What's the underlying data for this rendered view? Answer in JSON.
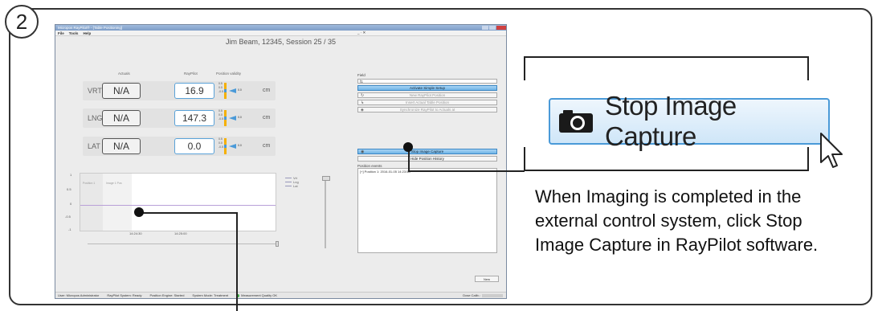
{
  "step_number": "2",
  "window": {
    "title": "Micropos RayPilot® - [Table Positioning]",
    "menu": [
      "File",
      "Tools",
      "Help"
    ],
    "menu_right": "_ · ✕"
  },
  "session_title": "Jim Beam, 12345, Session 25 / 35",
  "headers": {
    "actuals": "Actuals",
    "raypilot": "RayPilot",
    "validity": "Position validity"
  },
  "rows": [
    {
      "axis": "VRT",
      "actual": "N/A",
      "raypilot": "16.9",
      "unit": "cm",
      "arrow_value": "0.0"
    },
    {
      "axis": "LNG",
      "actual": "N/A",
      "raypilot": "147.3",
      "unit": "cm",
      "arrow_value": "0.0"
    },
    {
      "axis": "LAT",
      "actual": "N/A",
      "raypilot": "0.0",
      "unit": "cm",
      "arrow_value": "0.0"
    }
  ],
  "validity_ticks": [
    "0.5",
    "0.0",
    "-0.5"
  ],
  "plot": {
    "y_ticks": [
      "1",
      "0.5",
      "0",
      "-0.5",
      "-1"
    ],
    "x_ticks": [
      "14:24:30",
      "14:25:00"
    ],
    "region_labels": [
      "Position 1",
      "Image 1 Pos"
    ],
    "legend": [
      "Vrt",
      "Lng",
      "Lat"
    ]
  },
  "right_panel": {
    "field_label": "Field",
    "field_value": "f1",
    "buttons": {
      "activate": "Activate Simple Setup",
      "new_position": "New RayPilot Position",
      "insert_actual": "Insert Actual Table Position",
      "synchronize": "Synchronize RayPilot to Actuals at",
      "stop_capture": "Stop Image Capture",
      "hide_history": "Hide Position History"
    },
    "events_label": "Position events",
    "events": [
      "[+] Position 1: 2016-01-05 14:23:58"
    ],
    "new_button": "New"
  },
  "status_bar": {
    "user": "User: Micropos Administrator",
    "system": "RayPilot System: Ready",
    "engine": "Position Engine: Started",
    "mode": "System Mode: Treatment",
    "quality": "Measurement Quality OK",
    "dose": "Dose Calib.:"
  },
  "callout": {
    "button_label": "Stop Image Capture",
    "instruction": "When Imaging is completed in the external control system, click Stop Image Capture in RayPilot software."
  },
  "colors": {
    "accent_blue": "#4a9ad8",
    "validity_orange": "#f5b000",
    "ok_green": "#3cb043"
  }
}
